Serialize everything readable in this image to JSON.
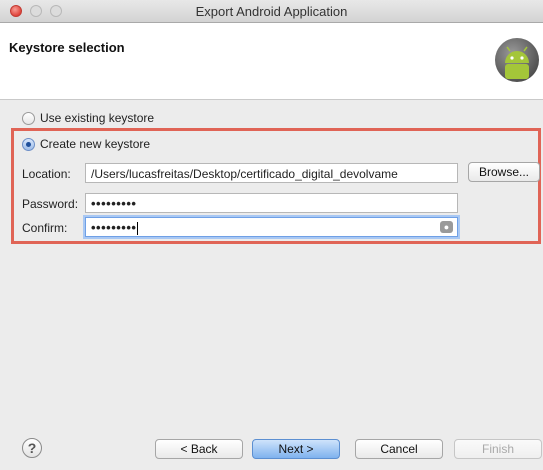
{
  "window": {
    "title": "Export Android Application"
  },
  "header": {
    "title": "Keystore selection"
  },
  "options": {
    "use_existing": "Use existing keystore",
    "create_new": "Create new keystore"
  },
  "form": {
    "location_label": "Location:",
    "location_value": "/Users/lucasfreitas/Desktop/certificado_digital_devolvame",
    "browse_label": "Browse...",
    "password_label": "Password:",
    "password_value": "•••••••••",
    "confirm_label": "Confirm:",
    "confirm_value": "•••••••••"
  },
  "footer": {
    "help_icon": "?",
    "back_label": "< Back",
    "next_label": "Next >",
    "cancel_label": "Cancel",
    "finish_label": "Finish"
  },
  "colors": {
    "highlight": "#e06456",
    "android_green": "#a4c639"
  }
}
